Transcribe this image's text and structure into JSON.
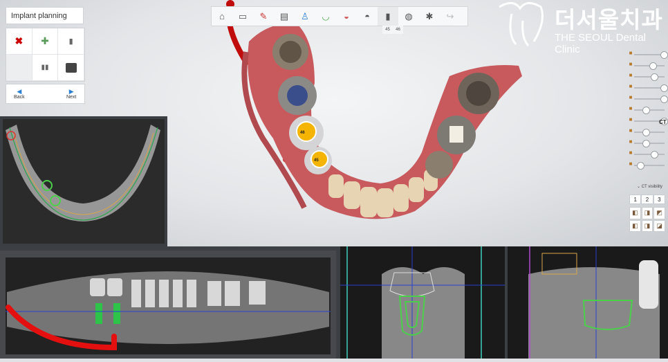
{
  "app": {
    "panel_title": "Implant planning",
    "nav": {
      "back_label": "Back",
      "next_label": "Next"
    },
    "tools": [
      "delete-icon",
      "add-implant-icon",
      "implant-icon",
      "",
      "abutment-icon",
      "sleeve-icon"
    ],
    "toolbar_icons": [
      "home-icon",
      "panorama-icon",
      "nerve-icon",
      "slice-icon",
      "tooth-icon",
      "arch-icon",
      "jaw-icon",
      "crown-icon",
      "implant-icon",
      "guide-icon",
      "settings-icon",
      "redo-icon"
    ],
    "toolbar_sub": [
      "45",
      "46"
    ],
    "logo": {
      "korean": "더서울치과",
      "english": "THE SEOUL Dental Clinic"
    },
    "right_panel": {
      "ct_label": "CT",
      "ct_visibility_label": "CT visibility",
      "view_numbers": [
        "1",
        "2",
        "3"
      ],
      "slider_levels": [
        0.95,
        0.55,
        0.6,
        0.95,
        0.95,
        0.3,
        0.95,
        0.3,
        0.3,
        0.6,
        0.1
      ]
    },
    "implant_markers": [
      "46",
      "45"
    ],
    "colors": {
      "accent": "#2a7fd4",
      "implant": "#f4b400",
      "gum": "#c85a5e",
      "nerve": "#e01818",
      "implant_outline": "#4bd04b"
    }
  }
}
